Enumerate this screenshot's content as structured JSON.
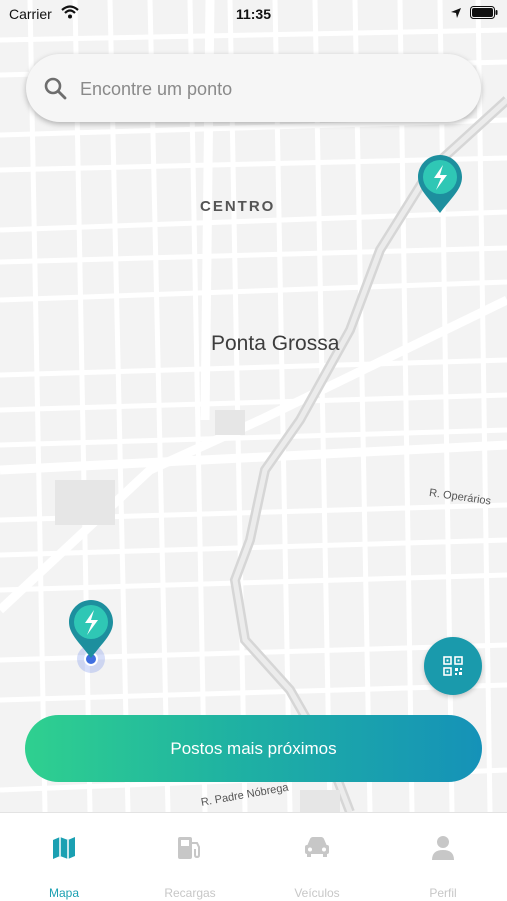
{
  "status_bar": {
    "carrier": "Carrier",
    "time": "11:35"
  },
  "search": {
    "placeholder": "Encontre um ponto",
    "icon": "search-icon"
  },
  "map": {
    "labels": {
      "district": "CENTRO",
      "city": "Ponta Grossa",
      "street_1": "R. Operários",
      "street_2": "R. Padre Nóbrega"
    },
    "markers": [
      "charging-station-pin-icon",
      "charging-station-pin-icon"
    ],
    "user_location": "user-location-dot"
  },
  "qr_button": {
    "icon": "qr-code-icon"
  },
  "cta": {
    "label": "Postos mais próximos"
  },
  "tabs": [
    {
      "label": "Mapa",
      "icon": "map-icon",
      "active": true
    },
    {
      "label": "Recargas",
      "icon": "fuel-station-icon",
      "active": false
    },
    {
      "label": "Veículos",
      "icon": "car-icon",
      "active": false
    },
    {
      "label": "Perfil",
      "icon": "person-icon",
      "active": false
    }
  ],
  "colors": {
    "accent": "#1ba0b2",
    "cta_gradient_start": "#2fd08f",
    "cta_gradient_end": "#1592b8",
    "user_location": "#3f6fe0"
  }
}
